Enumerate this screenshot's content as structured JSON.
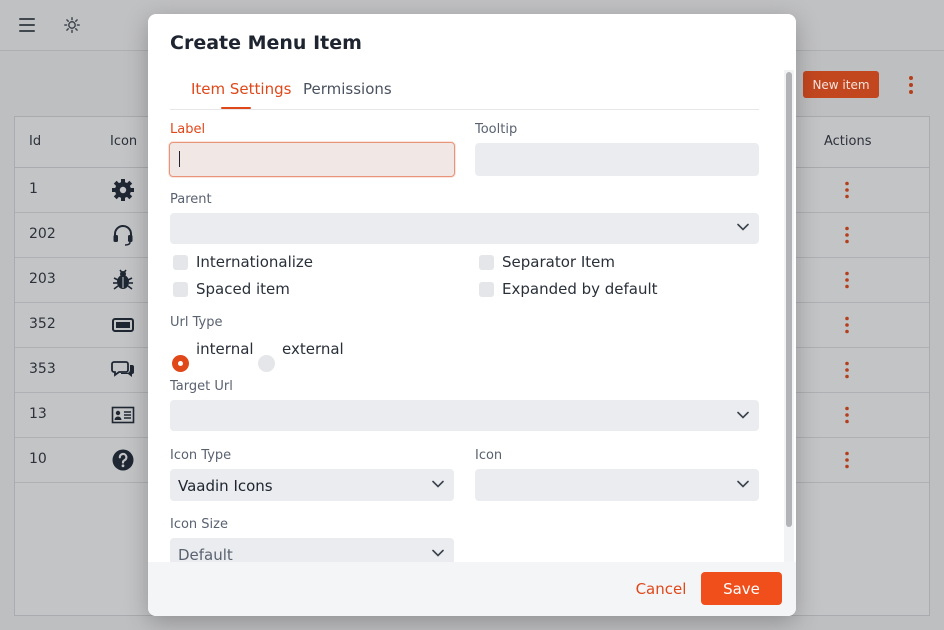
{
  "background": {
    "toolbar": {
      "menu_icon": "menu-icon",
      "theme_icon": "sun-icon"
    },
    "new_item_label": "New item",
    "grid": {
      "headers": {
        "id": "Id",
        "icon": "Icon",
        "actions": "Actions"
      },
      "rows": [
        {
          "id": "1",
          "icon": "cog-icon"
        },
        {
          "id": "202",
          "icon": "headset-icon"
        },
        {
          "id": "203",
          "icon": "bug-icon"
        },
        {
          "id": "352",
          "icon": "battery-icon"
        },
        {
          "id": "353",
          "icon": "chat-icon"
        },
        {
          "id": "13",
          "icon": "user-card-icon"
        },
        {
          "id": "10",
          "icon": "question-icon"
        }
      ]
    }
  },
  "dialog": {
    "title": "Create Menu Item",
    "tabs": [
      {
        "label": "Item Settings",
        "active": true
      },
      {
        "label": "Permissions",
        "active": false
      }
    ],
    "fields": {
      "label": {
        "label": "Label",
        "value": ""
      },
      "tooltip": {
        "label": "Tooltip",
        "value": ""
      },
      "parent": {
        "label": "Parent",
        "value": ""
      },
      "url_type": {
        "label": "Url Type",
        "options": [
          "internal",
          "external"
        ],
        "selected": "internal"
      },
      "target_url": {
        "label": "Target Url",
        "value": ""
      },
      "icon_type": {
        "label": "Icon Type",
        "value": "Vaadin Icons"
      },
      "icon": {
        "label": "Icon",
        "value": ""
      },
      "icon_size": {
        "label": "Icon Size",
        "value": "Default"
      }
    },
    "checkboxes": {
      "internationalize": {
        "label": "Internationalize",
        "checked": false
      },
      "separator": {
        "label": "Separator Item",
        "checked": false
      },
      "spaced": {
        "label": "Spaced item",
        "checked": false
      },
      "expanded": {
        "label": "Expanded by default",
        "checked": false
      }
    },
    "footer": {
      "cancel_label": "Cancel",
      "save_label": "Save"
    }
  },
  "colors": {
    "accent": "#f04f1c",
    "accent_text": "#e0481a",
    "overlay": "#bebfc1"
  }
}
